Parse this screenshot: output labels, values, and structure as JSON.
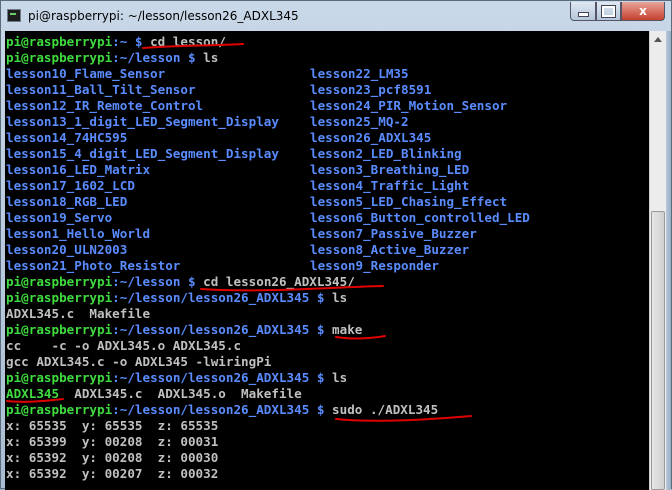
{
  "window": {
    "title": "pi@raspberrypi: ~/lesson/lesson26_ADXL345",
    "min_label": "",
    "max_label": "",
    "close_label": "x"
  },
  "terminal": {
    "prompt_user": "pi@raspberrypi",
    "lines": {
      "l1": {
        "path": ":~ $ ",
        "cmd": "cd lesson/"
      },
      "l2": {
        "path": ":~/lesson $ ",
        "cmd": "ls"
      },
      "ls_listing": [
        [
          "lesson10_Flame_Sensor",
          "lesson22_LM35"
        ],
        [
          "lesson11_Ball_Tilt_Sensor",
          "lesson23_pcf8591"
        ],
        [
          "lesson12_IR_Remote_Control",
          "lesson24_PIR_Motion_Sensor"
        ],
        [
          "lesson13_1_digit_LED_Segment_Display",
          "lesson25_MQ-2"
        ],
        [
          "lesson14_74HC595",
          "lesson26_ADXL345"
        ],
        [
          "lesson15_4_digit_LED_Segment_Display",
          "lesson2_LED_Blinking"
        ],
        [
          "lesson16_LED_Matrix",
          "lesson3_Breathing_LED"
        ],
        [
          "lesson17_1602_LCD",
          "lesson4_Traffic_Light"
        ],
        [
          "lesson18_RGB_LED",
          "lesson5_LED_Chasing_Effect"
        ],
        [
          "lesson19_Servo",
          "lesson6_Button_controlled_LED"
        ],
        [
          "lesson1_Hello_World",
          "lesson7_Passive_Buzzer"
        ],
        [
          "lesson20_ULN2003",
          "lesson8_Active_Buzzer"
        ],
        [
          "lesson21_Photo_Resistor",
          "lesson9_Responder"
        ]
      ],
      "l3": {
        "path": ":~/lesson $ ",
        "cmd": "cd lesson26_ADXL345/"
      },
      "l4": {
        "path": ":~/lesson/lesson26_ADXL345 $ ",
        "cmd": "ls"
      },
      "l5_out": "ADXL345.c  Makefile",
      "l6": {
        "path": ":~/lesson/lesson26_ADXL345 $ ",
        "cmd": "make"
      },
      "l7_out": "cc    -c -o ADXL345.o ADXL345.c",
      "l8_out": "gcc ADXL345.c -o ADXL345 -lwiringPi",
      "l9": {
        "path": ":~/lesson/lesson26_ADXL345 $ ",
        "cmd": "ls"
      },
      "l10_exec": "ADXL345",
      "l10_rest": "  ADXL345.c  ADXL345.o  Makefile",
      "l11": {
        "path": ":~/lesson/lesson26_ADXL345 $ ",
        "cmd": "sudo ./ADXL345"
      },
      "readings": [
        "x: 65535  y: 65535  z: 65535",
        "x: 65399  y: 00208  z: 00031",
        "x: 65392  y: 00208  z: 00030",
        "x: 65392  y: 00207  z: 00032"
      ]
    }
  },
  "colors": {
    "prompt_green": "#3fdc3f",
    "path_blue": "#5a8cff",
    "text_gray": "#c0c0c0",
    "annotation_red": "#e00000"
  }
}
